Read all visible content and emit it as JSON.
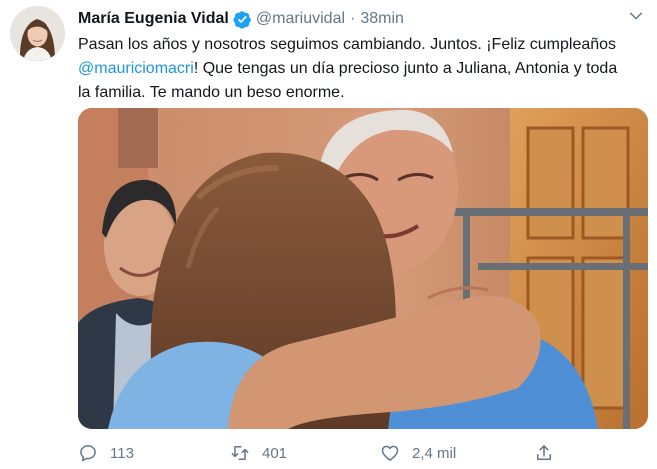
{
  "author": {
    "name": "María Eugenia Vidal",
    "handle": "@mariuvidal",
    "separator": "·",
    "time": "38min",
    "verified": true
  },
  "tweet": {
    "line1": "Pasan los años  y nosotros seguimos cambiando. Juntos. ¡Feliz cumpleaños",
    "mention": "@mauriciomacri",
    "line2_rest": "! Que tengas un día precioso junto a Juliana, Antonia y toda",
    "line3": "la familia. Te mando un beso enorme."
  },
  "actions": {
    "replies": "113",
    "retweets": "401",
    "likes": "2,4 mil"
  },
  "icons": {
    "verified": "verified-badge-icon",
    "caret": "chevron-down-icon",
    "reply": "reply-icon",
    "retweet": "retweet-icon",
    "like": "heart-icon",
    "share": "share-icon"
  },
  "colors": {
    "text": "#14171a",
    "secondary": "#657786",
    "link": "#1b95e0",
    "verified": "#1da1f2"
  }
}
